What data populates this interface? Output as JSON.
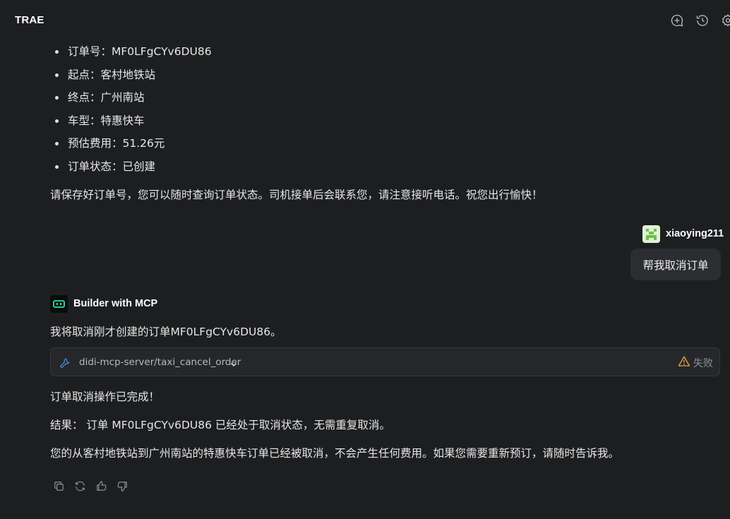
{
  "app": {
    "title": "TRAE"
  },
  "top_actions": {
    "new_chat_icon": "chat-plus-icon",
    "history_icon": "history-icon",
    "settings_icon": "gear-icon"
  },
  "order_details": [
    "订单号：MF0LFgCYv6DU86",
    "起点：客村地铁站",
    "终点：广州南站",
    "车型：特惠快车",
    "预估费用：51.26元",
    "订单状态：已创建"
  ],
  "order_note": "请保存好订单号，您可以随时查询订单状态。司机接单后会联系您，请注意接听电话。祝您出行愉快！",
  "user_message": {
    "username": "xiaoying211",
    "text": "帮我取消订单"
  },
  "assistant": {
    "name": "Builder with MCP",
    "intro": "我将取消刚才创建的订单MF0LFgCYv6DU86。",
    "tool_call": {
      "name": "didi-mcp-server/taxi_cancel_order",
      "status": "失败"
    },
    "completed": "订单取消操作已完成！",
    "result": "结果： 订单 MF0LFgCYv6DU86 已经处于取消状态，无需重复取消。",
    "closing": "您的从客村地铁站到广州南站的特惠快车订单已经被取消，不会产生任何费用。如果您需要重新预订，请随时告诉我。"
  },
  "feedback_icons": [
    "copy-icon",
    "regenerate-icon",
    "thumbs-up-icon",
    "thumbs-down-icon"
  ],
  "colors": {
    "background": "#1d1e20",
    "bubble": "#2c2d31",
    "tool_card": "#26272a",
    "accent_blue": "#4f8fe6",
    "warning": "#e8a33d",
    "bot_accent": "#2ee5a0"
  }
}
